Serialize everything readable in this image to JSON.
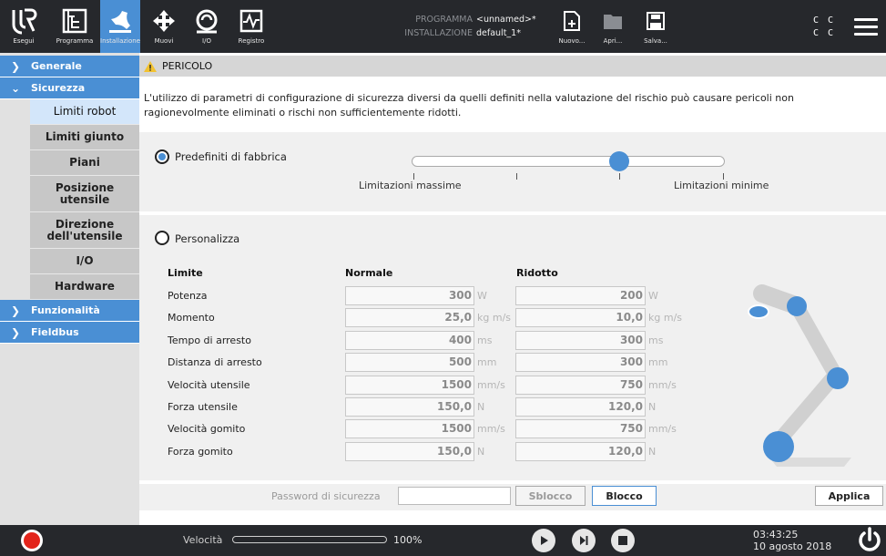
{
  "topbar": {
    "nav": [
      {
        "label": "Esegui",
        "icon": "ur-logo-icon"
      },
      {
        "label": "Programma",
        "icon": "program-icon"
      },
      {
        "label": "Installazione",
        "icon": "installation-icon"
      },
      {
        "label": "Muovi",
        "icon": "move-icon"
      },
      {
        "label": "I/O",
        "icon": "io-icon"
      },
      {
        "label": "Registro",
        "icon": "log-icon"
      }
    ],
    "program_key": "PROGRAMMA",
    "program_value": "<unnamed>*",
    "installation_key": "INSTALLAZIONE",
    "installation_value": "default_1*",
    "file_buttons": [
      {
        "label": "Nuovo...",
        "icon": "new-file-icon"
      },
      {
        "label": "Apri...",
        "icon": "folder-icon"
      },
      {
        "label": "Salva...",
        "icon": "save-icon"
      }
    ],
    "cc_line1": "C C",
    "cc_line2": "C C"
  },
  "sidebar": {
    "generale": "Generale",
    "sicurezza": "Sicurezza",
    "sub_items": [
      "Limiti robot",
      "Limiti giunto",
      "Piani",
      "Posizione utensile",
      "Direzione dell'utensile",
      "I/O",
      "Hardware"
    ],
    "funzionalita": "Funzionalità",
    "fieldbus": "Fieldbus"
  },
  "main": {
    "danger_title": "PERICOLO",
    "danger_text": "L'utilizzo di parametri di configurazione di sicurezza diversi da quelli definiti nella valutazione del rischio può causare pericoli non ragionevolmente eliminati o rischi non sufficientemente ridotti.",
    "factory_radio": "Predefiniti di fabbrica",
    "factory_selected": true,
    "slider_min_label": "Limitazioni massime",
    "slider_max_label": "Limitazioni minime",
    "custom_radio": "Personalizza",
    "table": {
      "col_limit": "Limite",
      "col_normal": "Normale",
      "col_reduced": "Ridotto",
      "rows": [
        {
          "label": "Potenza",
          "normal": "300",
          "reduced": "200",
          "unit": "W"
        },
        {
          "label": "Momento",
          "normal": "25,0",
          "reduced": "10,0",
          "unit": "kg m/s"
        },
        {
          "label": "Tempo di arresto",
          "normal": "400",
          "reduced": "300",
          "unit": "ms"
        },
        {
          "label": "Distanza di arresto",
          "normal": "500",
          "reduced": "300",
          "unit": "mm"
        },
        {
          "label": "Velocità utensile",
          "normal": "1500",
          "reduced": "750",
          "unit": "mm/s"
        },
        {
          "label": "Forza utensile",
          "normal": "150,0",
          "reduced": "120,0",
          "unit": "N"
        },
        {
          "label": "Velocità gomito",
          "normal": "1500",
          "reduced": "750",
          "unit": "mm/s"
        },
        {
          "label": "Forza gomito",
          "normal": "150,0",
          "reduced": "120,0",
          "unit": "N"
        }
      ]
    },
    "password_label": "Password di sicurezza",
    "unlock_button": "Sblocco",
    "lock_button": "Blocco",
    "apply_button": "Applica"
  },
  "footer": {
    "speed_label": "Velocità",
    "speed_value": "100%",
    "time": "03:43:25",
    "date": "10 agosto 2018"
  },
  "colors": {
    "accent": "#4a8fd4",
    "topbar_bg": "#26282c",
    "record": "#e3241b"
  }
}
